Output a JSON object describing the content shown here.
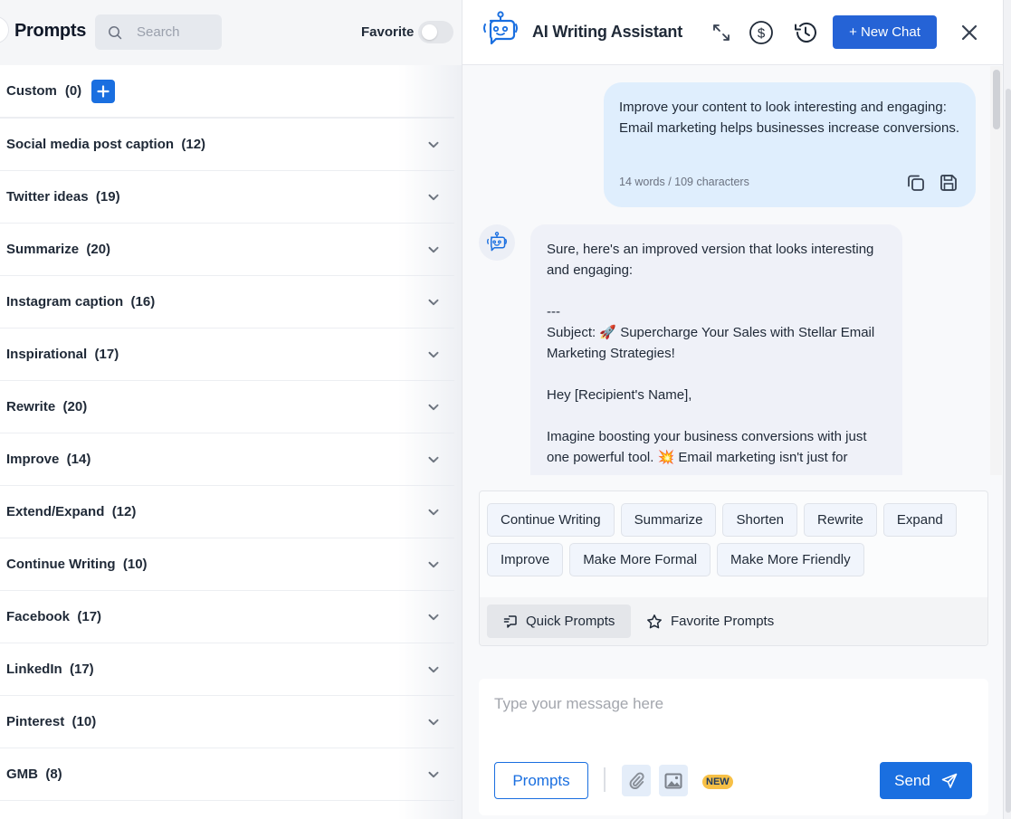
{
  "left_panel": {
    "title": "Prompts",
    "search": {
      "placeholder": "Search",
      "value": ""
    },
    "favorite_label": "Favorite",
    "favorite_toggle_on": false,
    "custom": {
      "label": "Custom",
      "count": "(0)"
    },
    "categories": [
      {
        "label": "Social media post caption  (12)"
      },
      {
        "label": "Twitter ideas  (19)"
      },
      {
        "label": "Summarize  (20)"
      },
      {
        "label": "Instagram caption  (16)"
      },
      {
        "label": "Inspirational  (17)"
      },
      {
        "label": "Rewrite  (20)"
      },
      {
        "label": "Improve  (14)"
      },
      {
        "label": "Extend/Expand  (12)"
      },
      {
        "label": "Continue Writing  (10)"
      },
      {
        "label": "Facebook  (17)"
      },
      {
        "label": "LinkedIn  (17)"
      },
      {
        "label": "Pinterest  (10)"
      },
      {
        "label": "GMB  (8)"
      }
    ]
  },
  "assistant": {
    "title": "AI Writing Assistant",
    "new_chat_label": "+ New Chat",
    "icons": [
      "robot-icon",
      "expand-icon",
      "dollar-icon",
      "history-icon",
      "close-icon"
    ],
    "accent_color": "#1a6fe0",
    "user_message": {
      "text": "Improve your content to look interesting and engaging: Email marketing helps businesses increase conversions.",
      "meta": "14 words / 109 characters"
    },
    "bot_message": {
      "lines": [
        "Sure, here's an improved version that looks interesting and engaging:",
        "",
        "---",
        "Subject: 🚀 Supercharge Your Sales with Stellar Email Marketing Strategies!",
        "",
        "Hey [Recipient's Name],",
        "",
        "Imagine boosting your business conversions with just one powerful tool. 💥 Email marketing isn't just for"
      ]
    },
    "quick_actions": [
      "Continue Writing",
      "Summarize",
      "Shorten",
      "Rewrite",
      "Expand",
      "Improve",
      "Make More Formal",
      "Make More Friendly"
    ],
    "prompt_tabs": [
      {
        "label": "Quick Prompts",
        "active": true
      },
      {
        "label": "Favorite Prompts",
        "active": false
      }
    ],
    "composer": {
      "placeholder": "Type your message here",
      "value": "",
      "prompts_label": "Prompts",
      "new_badge": "NEW",
      "send_label": "Send"
    }
  }
}
